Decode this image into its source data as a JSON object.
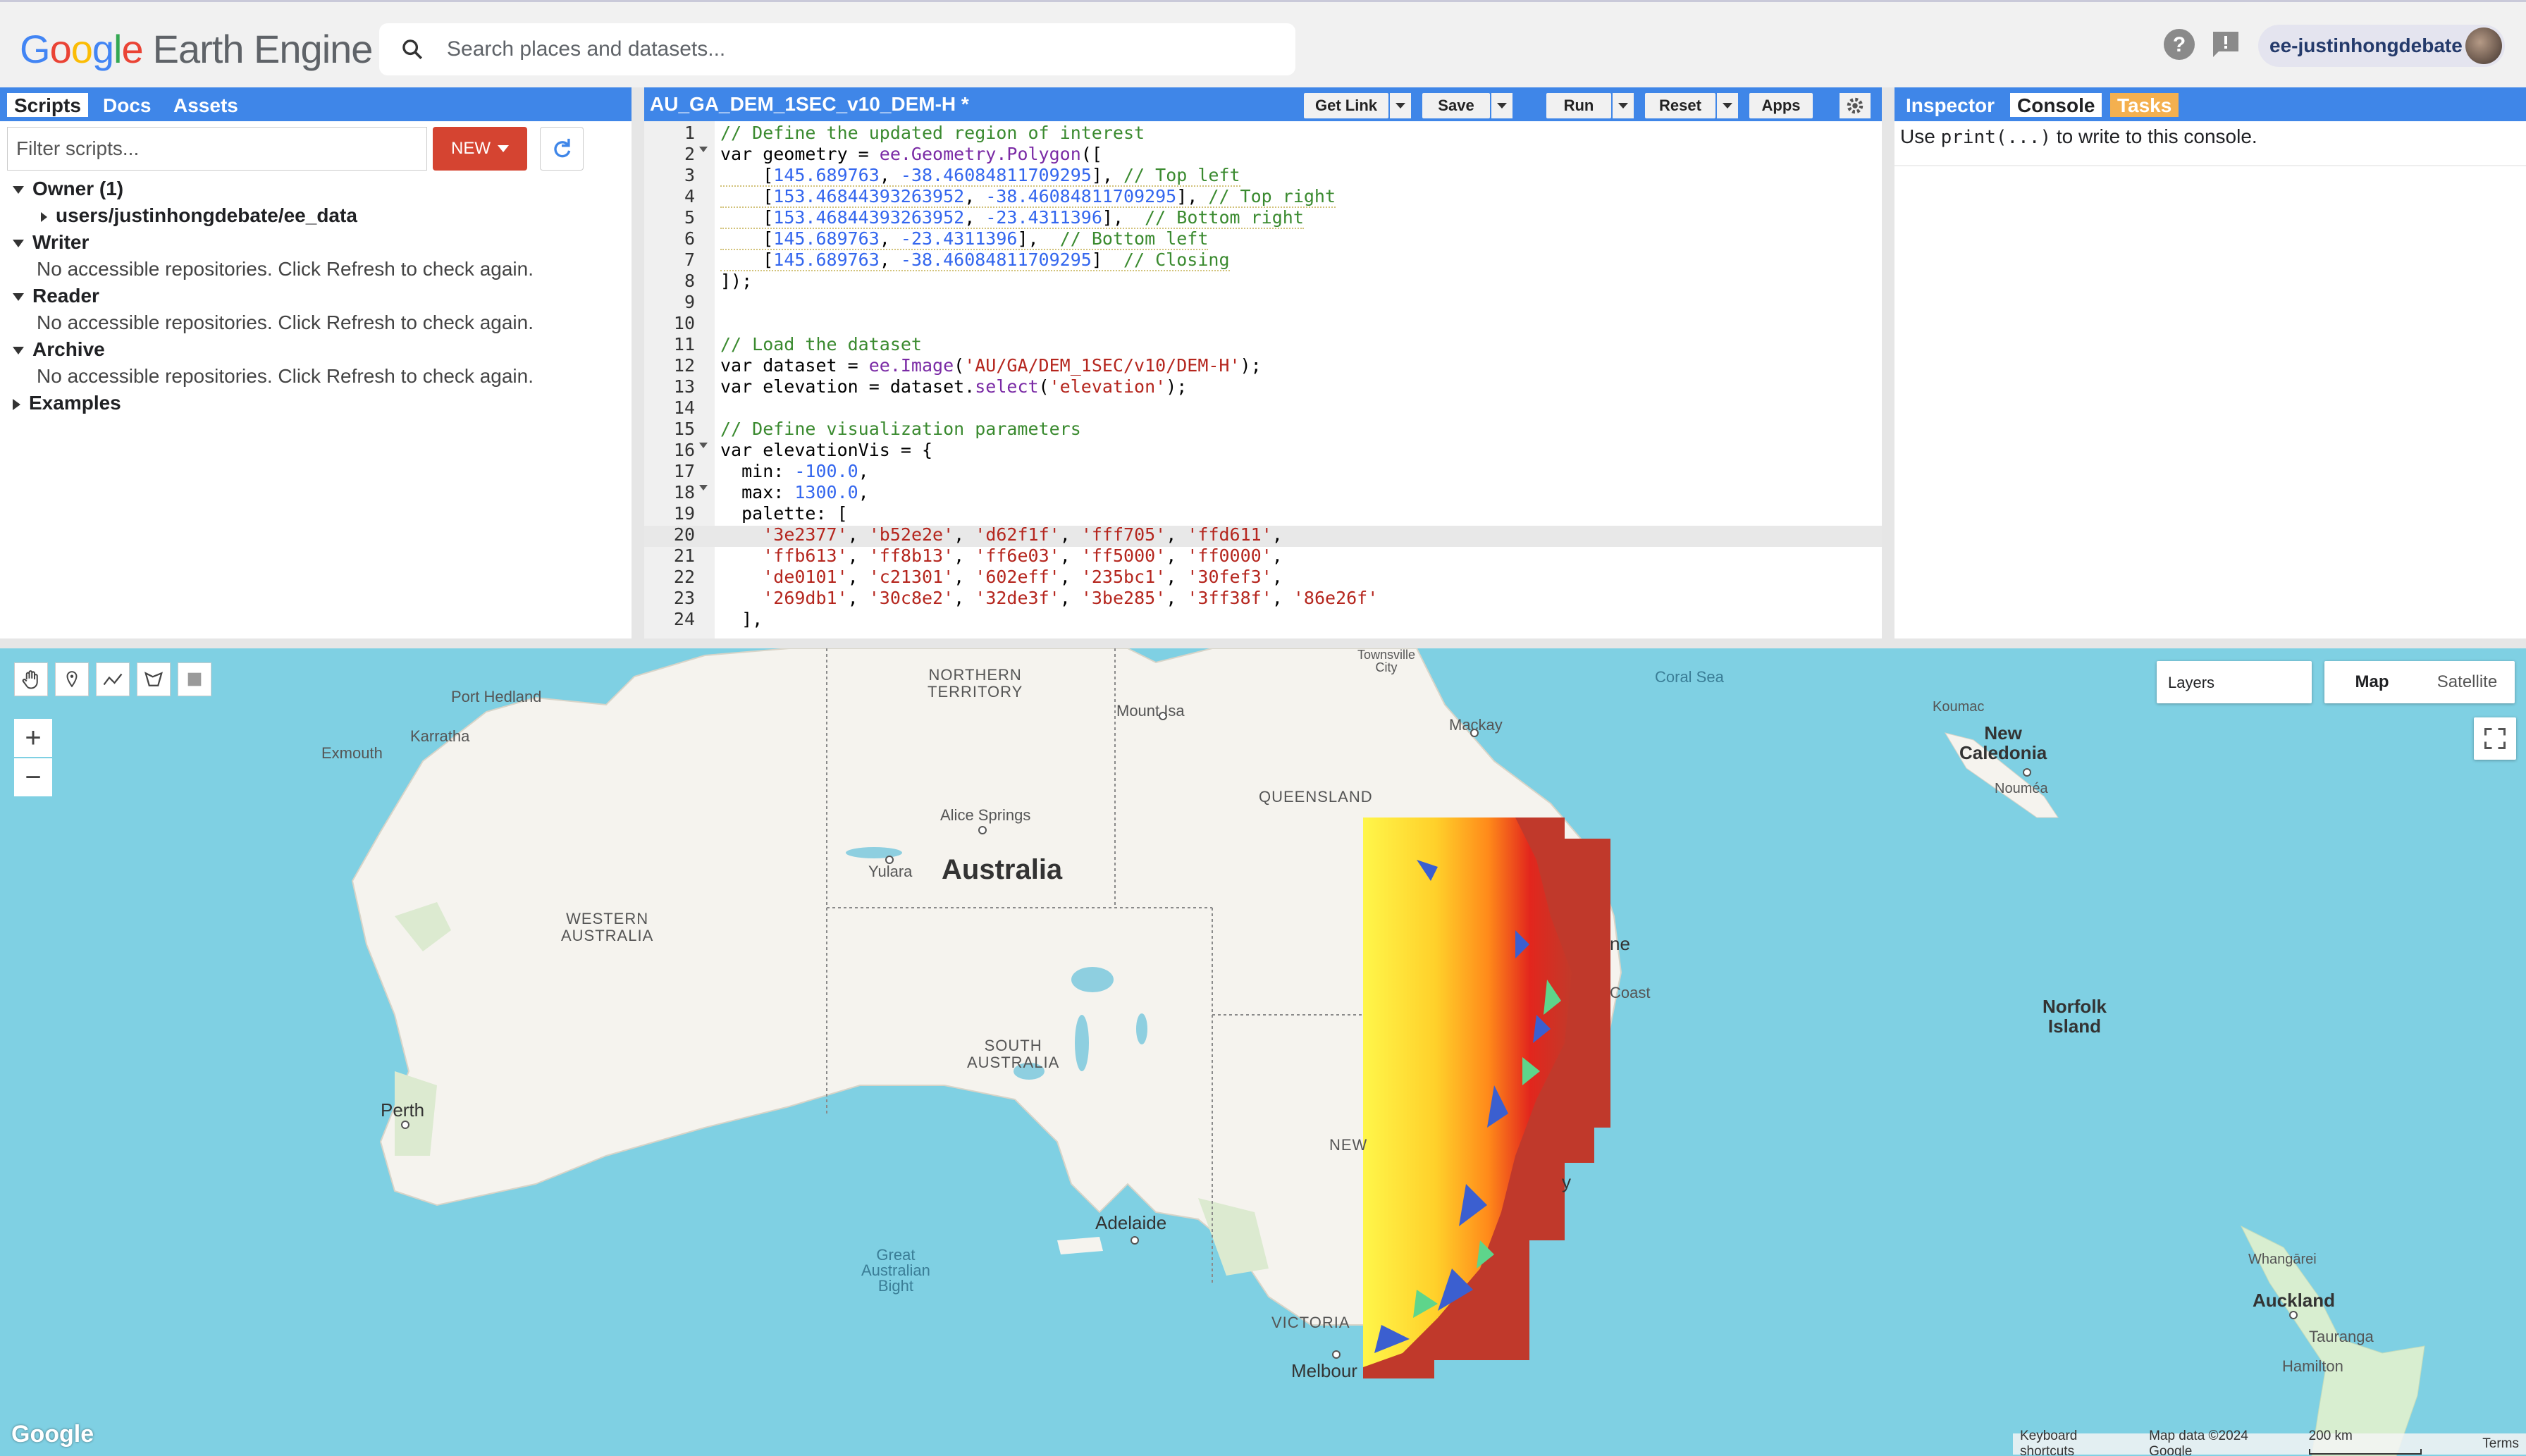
{
  "app": {
    "logo_google": [
      "G",
      "o",
      "o",
      "g",
      "l",
      "e"
    ],
    "logo_product": "Earth Engine",
    "search_placeholder": "Search places and datasets...",
    "user": "ee-justinhongdebate"
  },
  "left_panel": {
    "tabs": [
      "Scripts",
      "Docs",
      "Assets"
    ],
    "filter_placeholder": "Filter scripts...",
    "new_label": "NEW",
    "tree": {
      "owner": "Owner (1)",
      "owner_child": "users/justinhongdebate/ee_data",
      "writer": "Writer",
      "writer_msg": "No accessible repositories. Click Refresh to check again.",
      "reader": "Reader",
      "reader_msg": "No accessible repositories. Click Refresh to check again.",
      "archive": "Archive",
      "archive_msg": "No accessible repositories. Click Refresh to check again.",
      "examples": "Examples"
    }
  },
  "editor": {
    "title": "AU_GA_DEM_1SEC_v10_DEM-H *",
    "buttons": {
      "get_link": "Get Link",
      "save": "Save",
      "run": "Run",
      "reset": "Reset",
      "apps": "Apps"
    },
    "line_numbers": [
      "1",
      "2",
      "3",
      "4",
      "5",
      "6",
      "7",
      "8",
      "9",
      "10",
      "11",
      "12",
      "13",
      "14",
      "15",
      "16",
      "17",
      "18",
      "19",
      "20",
      "21",
      "22",
      "23",
      "24"
    ]
  },
  "right_panel": {
    "tabs": [
      "Inspector",
      "Console",
      "Tasks"
    ],
    "console_pre": "Use",
    "console_code": "print(...)",
    "console_post": "to write to this console."
  },
  "map": {
    "layers_label": "Layers",
    "map_type": [
      "Map",
      "Satellite"
    ],
    "labels": {
      "northern_territory": "NORTHERN\nTERRITORY",
      "queensland": "QUEENSLAND",
      "western_australia": "WESTERN\nAUSTRALIA",
      "south_australia": "SOUTH\nAUSTRALIA",
      "victoria": "VICTORIA",
      "new_south_wales": "NEW",
      "australia": "Australia",
      "coral_sea": "Coral Sea",
      "great_australian_bight": "Great\nAustralian\nBight",
      "new_caledonia": "New\nCaledonia",
      "norfolk_island": "Norfolk\nIsland",
      "port_hedland": "Port Hedland",
      "karratha": "Karratha",
      "exmouth": "Exmouth",
      "mount_isa": "Mount Isa",
      "mackay": "Mackay",
      "alice_springs": "Alice Springs",
      "yulara": "Yulara",
      "perth": "Perth",
      "adelaide": "Adelaide",
      "melbourne": "Melbour",
      "brisbane_fragment": "ne",
      "gold_coast_fragment": "Coast",
      "sydney_fragment": "y",
      "townsville": "Townsville\nCity",
      "koumac": "Koumac",
      "noumea": "Nouméa",
      "whangarei": "Whangārei",
      "auckland": "Auckland",
      "tauranga": "Tauranga",
      "hamilton": "Hamilton"
    },
    "attribution": {
      "shortcuts": "Keyboard shortcuts",
      "data": "Map data ©2024 Google",
      "scale": "200 km",
      "terms": "Terms"
    },
    "google": "Google"
  },
  "colors": {
    "panel_blue": "#3f86e8",
    "new_button": "#d54431",
    "tasks_tab": "#f4b04f",
    "ocean": "#7fd0e3",
    "land": "#f5f3ee"
  }
}
